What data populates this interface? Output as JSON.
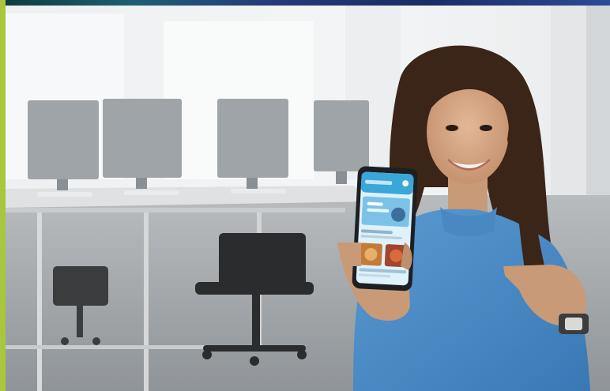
{
  "image": {
    "description_icons": [
      "office-background",
      "woman-photo",
      "smartphone-icon",
      "food-thumbnail-icon"
    ],
    "colors": {
      "accent_bar": "#a8c73c",
      "shirt": "#4f8fc8",
      "phone_screen": "#dff1fb",
      "phone_header": "#3aa7d8"
    }
  }
}
